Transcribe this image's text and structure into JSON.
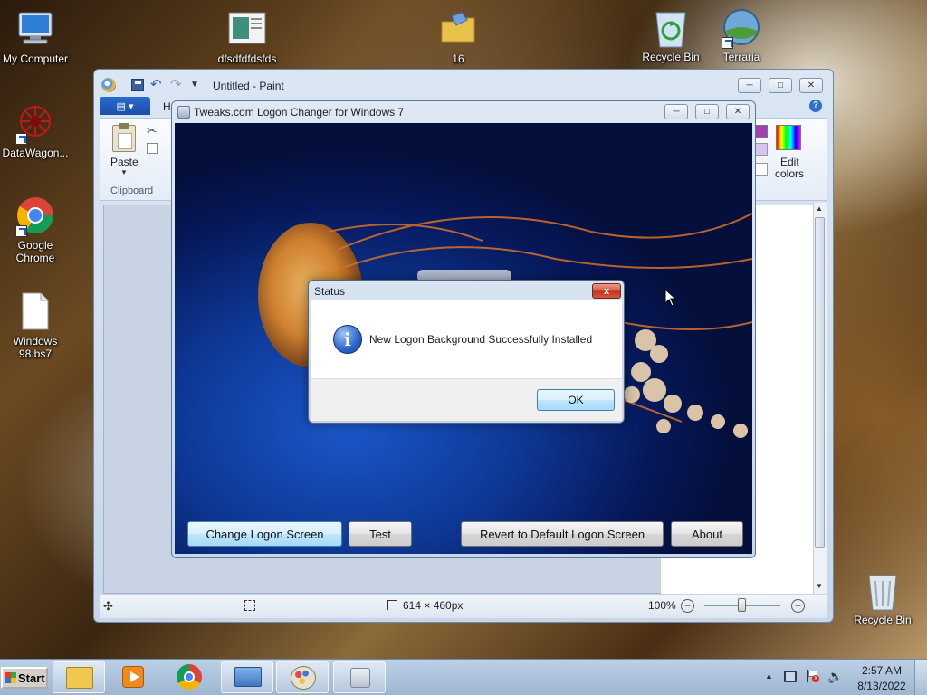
{
  "desktop": {
    "icons": [
      {
        "label": "My Computer",
        "icon": "computer-icon"
      },
      {
        "label": "dfsdfdfdsfds",
        "icon": "image-file-icon"
      },
      {
        "label": "16",
        "icon": "folder-icon"
      },
      {
        "label": "Recycle Bin",
        "icon": "recycle-bin-full-icon"
      },
      {
        "label": "Terraria",
        "icon": "terraria-icon"
      },
      {
        "label": "DataWagon...",
        "icon": "datawagon-icon"
      },
      {
        "label": "Google Chrome",
        "icon": "chrome-icon"
      },
      {
        "label": "Windows 98.bs7",
        "icon": "file-icon"
      },
      {
        "label": "Recycle Bin",
        "icon": "recycle-bin-empty-icon"
      }
    ]
  },
  "paint": {
    "title": "Untitled - Paint",
    "home_tab": "H",
    "paste_label": "Paste",
    "clipboard_group": "Clipboard",
    "edit_colors_line1": "Edit",
    "edit_colors_line2": "colors",
    "status_size": "614 × 460px",
    "zoom": "100%"
  },
  "tweaks": {
    "title": "Tweaks.com Logon Changer for Windows 7",
    "buttons": {
      "change": "Change Logon Screen",
      "test": "Test",
      "revert": "Revert to Default Logon Screen",
      "about": "About"
    }
  },
  "dialog": {
    "title": "Status",
    "message": "New Logon Background Successfully Installed",
    "ok": "OK",
    "close": "x"
  },
  "taskbar": {
    "start_label": "Start",
    "time": "2:57 AM",
    "date": "8/13/2022"
  },
  "colors": {
    "accent_blue": "#1e5fc2",
    "close_red": "#c2311a",
    "taskbar": "#9db6d2"
  }
}
